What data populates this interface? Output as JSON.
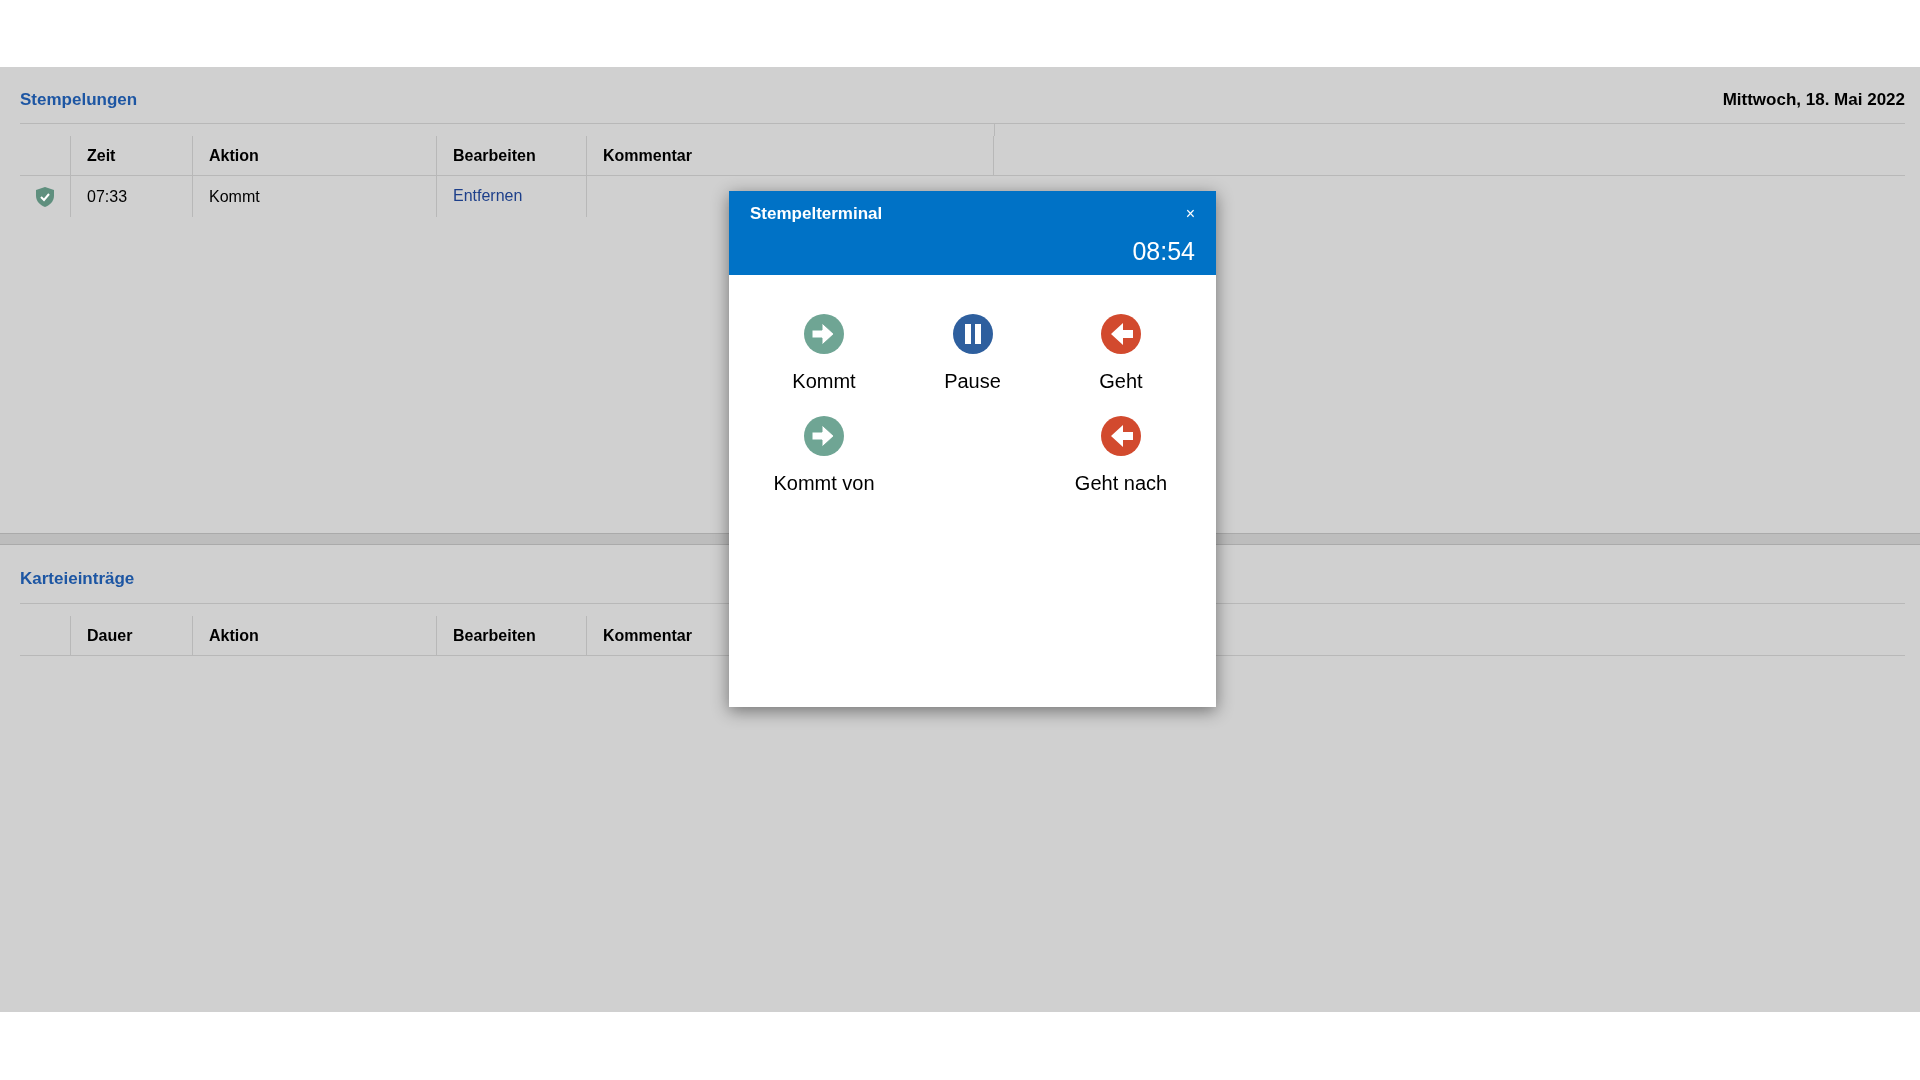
{
  "stempelungen": {
    "title": "Stempelungen",
    "date": "Mittwoch, 18. Mai 2022",
    "columns": [
      "Zeit",
      "Aktion",
      "Bearbeiten",
      "Kommentar"
    ],
    "rows": [
      {
        "time": "07:33",
        "action": "Kommt",
        "edit_link": "Entfernen"
      }
    ]
  },
  "karteieintraege": {
    "title": "Karteieinträge",
    "columns": [
      "Dauer",
      "Aktion",
      "Bearbeiten",
      "Kommentar"
    ]
  },
  "dialog": {
    "title": "Stempelterminal",
    "close": "×",
    "clock": "08:54",
    "button_rows": [
      {
        "left": {
          "kind": "arrive",
          "label": "Kommt"
        },
        "center": {
          "kind": "pause",
          "label": "Pause"
        },
        "right": {
          "kind": "leave",
          "label": "Geht"
        }
      },
      {
        "left": {
          "kind": "arrive",
          "label": "Kommt von"
        },
        "right": {
          "kind": "leave",
          "label": "Geht nach"
        }
      }
    ]
  }
}
